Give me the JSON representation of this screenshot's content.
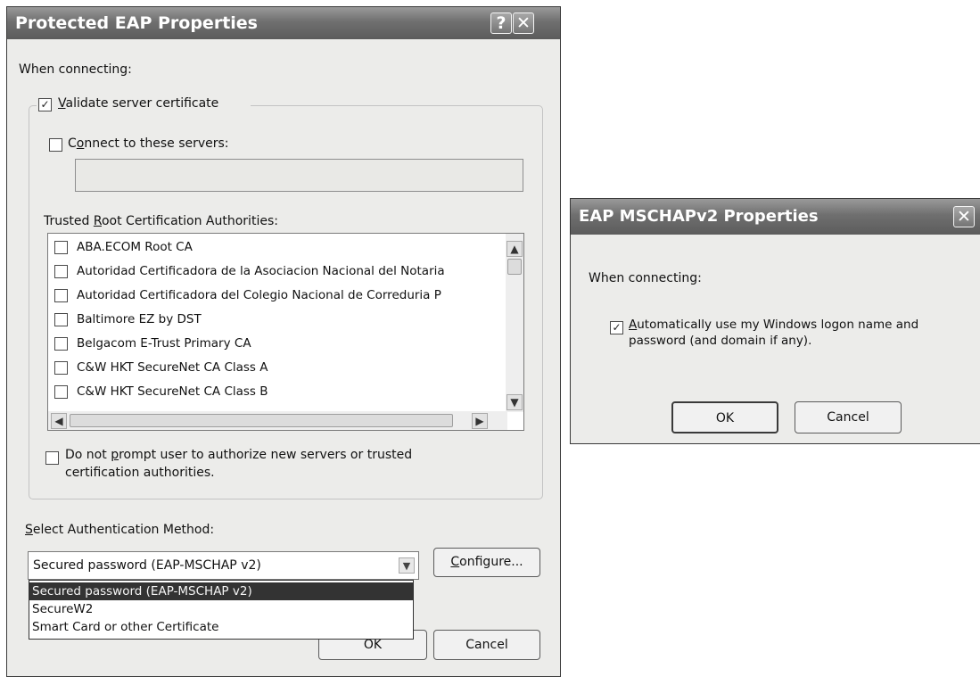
{
  "peap": {
    "title": "Protected EAP Properties",
    "help_glyph": "?",
    "close_glyph": "✕",
    "when_connecting": "When connecting:",
    "validate_label_a": "V",
    "validate_label_b": "alidate server certificate",
    "validate_checked": true,
    "connect_label_a": "C",
    "connect_label_b": "o",
    "connect_label_c": "nnect to these servers:",
    "connect_checked": false,
    "servers_value": "",
    "trusted_label_a": "Trusted ",
    "trusted_label_b": "R",
    "trusted_label_c": "oot Certification Authorities:",
    "ca_list": [
      "ABA.ECOM Root CA",
      "Autoridad Certificadora de la Asociacion Nacional del Notaria",
      "Autoridad Certificadora del Colegio Nacional de Correduria P",
      "Baltimore EZ by DST",
      "Belgacom E-Trust Primary CA",
      "C&W HKT SecureNet CA Class A",
      "C&W HKT SecureNet CA Class B"
    ],
    "noprompt_line1_a": "Do not ",
    "noprompt_line1_b": "p",
    "noprompt_line1_c": "rompt user to authorize new servers or trusted",
    "noprompt_line2": "certification authorities.",
    "noprompt_checked": false,
    "select_method_a": "S",
    "select_method_b": "elect Authentication Method:",
    "method_value": "Secured password (EAP-MSCHAP v2)",
    "configure_a": "C",
    "configure_b": "onfigure...",
    "dropdown_options": [
      "Secured password (EAP-MSCHAP v2)",
      "SecureW2",
      "Smart Card or other Certificate"
    ],
    "dropdown_selected_index": 0,
    "ok_label": "OK",
    "cancel_label": "Cancel"
  },
  "mschap": {
    "title": "EAP MSCHAPv2 Properties",
    "close_glyph": "✕",
    "when_connecting": "When connecting:",
    "auto_line1_a": "A",
    "auto_line1_b": "utomatically use my Windows logon name and",
    "auto_line2": "password (and domain if any).",
    "auto_checked": true,
    "ok_label": "OK",
    "cancel_label": "Cancel"
  },
  "glyphs": {
    "check": "✓",
    "scroll_up": "▲",
    "scroll_down": "▼",
    "scroll_left": "◀",
    "scroll_right": "▶",
    "combo_arrow": "▼"
  }
}
